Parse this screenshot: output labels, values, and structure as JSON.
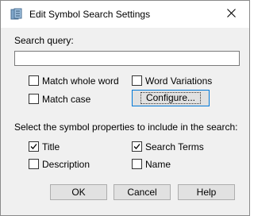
{
  "window": {
    "title": "Edit Symbol Search Settings",
    "icon": "search-settings-icon",
    "close_icon": "close-icon"
  },
  "search": {
    "label": "Search query:",
    "value": "",
    "placeholder": ""
  },
  "options": {
    "match_whole_word": {
      "label": "Match whole word",
      "checked": false
    },
    "word_variations": {
      "label": "Word Variations",
      "checked": false
    },
    "match_case": {
      "label": "Match case",
      "checked": false
    },
    "configure_label": "Configure..."
  },
  "properties": {
    "label": "Select the symbol properties to include in the search:",
    "title": {
      "label": "Title",
      "checked": true
    },
    "search_terms": {
      "label": "Search Terms",
      "checked": true
    },
    "description": {
      "label": "Description",
      "checked": false
    },
    "name": {
      "label": "Name",
      "checked": false
    }
  },
  "buttons": {
    "ok": "OK",
    "cancel": "Cancel",
    "help": "Help"
  },
  "colors": {
    "dialog_bg": "#f0f0f0",
    "titlebar_bg": "#ffffff",
    "focus_border": "#0078d7"
  }
}
